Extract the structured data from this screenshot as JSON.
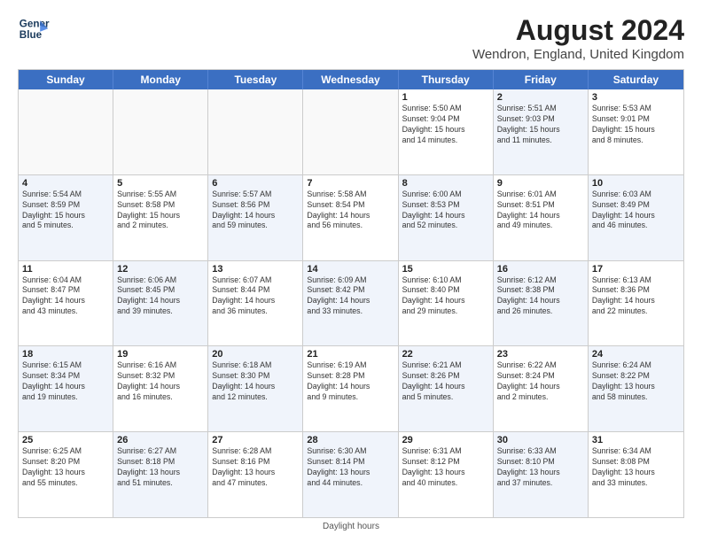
{
  "logo": {
    "line1": "General",
    "line2": "Blue"
  },
  "title": "August 2024",
  "subtitle": "Wendron, England, United Kingdom",
  "days_of_week": [
    "Sunday",
    "Monday",
    "Tuesday",
    "Wednesday",
    "Thursday",
    "Friday",
    "Saturday"
  ],
  "footer": "Daylight hours",
  "weeks": [
    [
      {
        "num": "",
        "info": "",
        "empty": true
      },
      {
        "num": "",
        "info": "",
        "empty": true
      },
      {
        "num": "",
        "info": "",
        "empty": true
      },
      {
        "num": "",
        "info": "",
        "empty": true
      },
      {
        "num": "1",
        "info": "Sunrise: 5:50 AM\nSunset: 9:04 PM\nDaylight: 15 hours\nand 14 minutes.",
        "alt": false
      },
      {
        "num": "2",
        "info": "Sunrise: 5:51 AM\nSunset: 9:03 PM\nDaylight: 15 hours\nand 11 minutes.",
        "alt": true
      },
      {
        "num": "3",
        "info": "Sunrise: 5:53 AM\nSunset: 9:01 PM\nDaylight: 15 hours\nand 8 minutes.",
        "alt": false
      }
    ],
    [
      {
        "num": "4",
        "info": "Sunrise: 5:54 AM\nSunset: 8:59 PM\nDaylight: 15 hours\nand 5 minutes.",
        "alt": true
      },
      {
        "num": "5",
        "info": "Sunrise: 5:55 AM\nSunset: 8:58 PM\nDaylight: 15 hours\nand 2 minutes.",
        "alt": false
      },
      {
        "num": "6",
        "info": "Sunrise: 5:57 AM\nSunset: 8:56 PM\nDaylight: 14 hours\nand 59 minutes.",
        "alt": true
      },
      {
        "num": "7",
        "info": "Sunrise: 5:58 AM\nSunset: 8:54 PM\nDaylight: 14 hours\nand 56 minutes.",
        "alt": false
      },
      {
        "num": "8",
        "info": "Sunrise: 6:00 AM\nSunset: 8:53 PM\nDaylight: 14 hours\nand 52 minutes.",
        "alt": true
      },
      {
        "num": "9",
        "info": "Sunrise: 6:01 AM\nSunset: 8:51 PM\nDaylight: 14 hours\nand 49 minutes.",
        "alt": false
      },
      {
        "num": "10",
        "info": "Sunrise: 6:03 AM\nSunset: 8:49 PM\nDaylight: 14 hours\nand 46 minutes.",
        "alt": true
      }
    ],
    [
      {
        "num": "11",
        "info": "Sunrise: 6:04 AM\nSunset: 8:47 PM\nDaylight: 14 hours\nand 43 minutes.",
        "alt": false
      },
      {
        "num": "12",
        "info": "Sunrise: 6:06 AM\nSunset: 8:45 PM\nDaylight: 14 hours\nand 39 minutes.",
        "alt": true
      },
      {
        "num": "13",
        "info": "Sunrise: 6:07 AM\nSunset: 8:44 PM\nDaylight: 14 hours\nand 36 minutes.",
        "alt": false
      },
      {
        "num": "14",
        "info": "Sunrise: 6:09 AM\nSunset: 8:42 PM\nDaylight: 14 hours\nand 33 minutes.",
        "alt": true
      },
      {
        "num": "15",
        "info": "Sunrise: 6:10 AM\nSunset: 8:40 PM\nDaylight: 14 hours\nand 29 minutes.",
        "alt": false
      },
      {
        "num": "16",
        "info": "Sunrise: 6:12 AM\nSunset: 8:38 PM\nDaylight: 14 hours\nand 26 minutes.",
        "alt": true
      },
      {
        "num": "17",
        "info": "Sunrise: 6:13 AM\nSunset: 8:36 PM\nDaylight: 14 hours\nand 22 minutes.",
        "alt": false
      }
    ],
    [
      {
        "num": "18",
        "info": "Sunrise: 6:15 AM\nSunset: 8:34 PM\nDaylight: 14 hours\nand 19 minutes.",
        "alt": true
      },
      {
        "num": "19",
        "info": "Sunrise: 6:16 AM\nSunset: 8:32 PM\nDaylight: 14 hours\nand 16 minutes.",
        "alt": false
      },
      {
        "num": "20",
        "info": "Sunrise: 6:18 AM\nSunset: 8:30 PM\nDaylight: 14 hours\nand 12 minutes.",
        "alt": true
      },
      {
        "num": "21",
        "info": "Sunrise: 6:19 AM\nSunset: 8:28 PM\nDaylight: 14 hours\nand 9 minutes.",
        "alt": false
      },
      {
        "num": "22",
        "info": "Sunrise: 6:21 AM\nSunset: 8:26 PM\nDaylight: 14 hours\nand 5 minutes.",
        "alt": true
      },
      {
        "num": "23",
        "info": "Sunrise: 6:22 AM\nSunset: 8:24 PM\nDaylight: 14 hours\nand 2 minutes.",
        "alt": false
      },
      {
        "num": "24",
        "info": "Sunrise: 6:24 AM\nSunset: 8:22 PM\nDaylight: 13 hours\nand 58 minutes.",
        "alt": true
      }
    ],
    [
      {
        "num": "25",
        "info": "Sunrise: 6:25 AM\nSunset: 8:20 PM\nDaylight: 13 hours\nand 55 minutes.",
        "alt": false
      },
      {
        "num": "26",
        "info": "Sunrise: 6:27 AM\nSunset: 8:18 PM\nDaylight: 13 hours\nand 51 minutes.",
        "alt": true
      },
      {
        "num": "27",
        "info": "Sunrise: 6:28 AM\nSunset: 8:16 PM\nDaylight: 13 hours\nand 47 minutes.",
        "alt": false
      },
      {
        "num": "28",
        "info": "Sunrise: 6:30 AM\nSunset: 8:14 PM\nDaylight: 13 hours\nand 44 minutes.",
        "alt": true
      },
      {
        "num": "29",
        "info": "Sunrise: 6:31 AM\nSunset: 8:12 PM\nDaylight: 13 hours\nand 40 minutes.",
        "alt": false
      },
      {
        "num": "30",
        "info": "Sunrise: 6:33 AM\nSunset: 8:10 PM\nDaylight: 13 hours\nand 37 minutes.",
        "alt": true
      },
      {
        "num": "31",
        "info": "Sunrise: 6:34 AM\nSunset: 8:08 PM\nDaylight: 13 hours\nand 33 minutes.",
        "alt": false
      }
    ]
  ]
}
